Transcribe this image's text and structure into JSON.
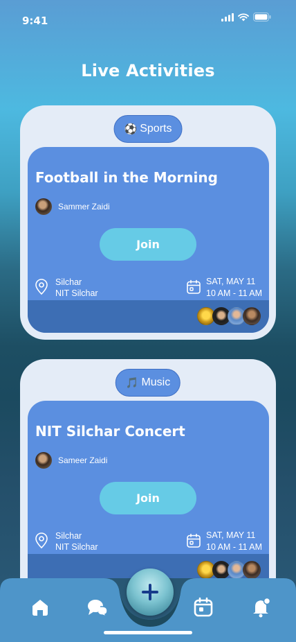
{
  "status_bar": {
    "time": "9:41"
  },
  "page": {
    "title": "Live Activities"
  },
  "activities": [
    {
      "category": {
        "emoji": "⚽",
        "label": "Sports"
      },
      "title": "Football in the Morning",
      "host": "Sammer Zaidi",
      "join_label": "Join",
      "location": {
        "line1": "Silchar",
        "line2": "NIT Silchar"
      },
      "date": "SAT, MAY 11",
      "time": "10 AM - 11 AM"
    },
    {
      "category": {
        "emoji": "🎵",
        "label": "Music"
      },
      "title": "NIT Silchar Concert",
      "host": "Sameer Zaidi",
      "join_label": "Join",
      "location": {
        "line1": "Silchar",
        "line2": "NIT Silchar"
      },
      "date": "SAT, MAY 11",
      "time": "10 AM - 11 AM"
    }
  ],
  "nav": {
    "items": [
      "home-icon",
      "chat-icon",
      "add-icon",
      "calendar-icon",
      "notification-icon"
    ]
  },
  "colors": {
    "card_bg": "#e4ecf7",
    "inner_card": "#5b8fe0",
    "join_button": "#66cbe6",
    "nav_bar": "#4e95c9"
  }
}
